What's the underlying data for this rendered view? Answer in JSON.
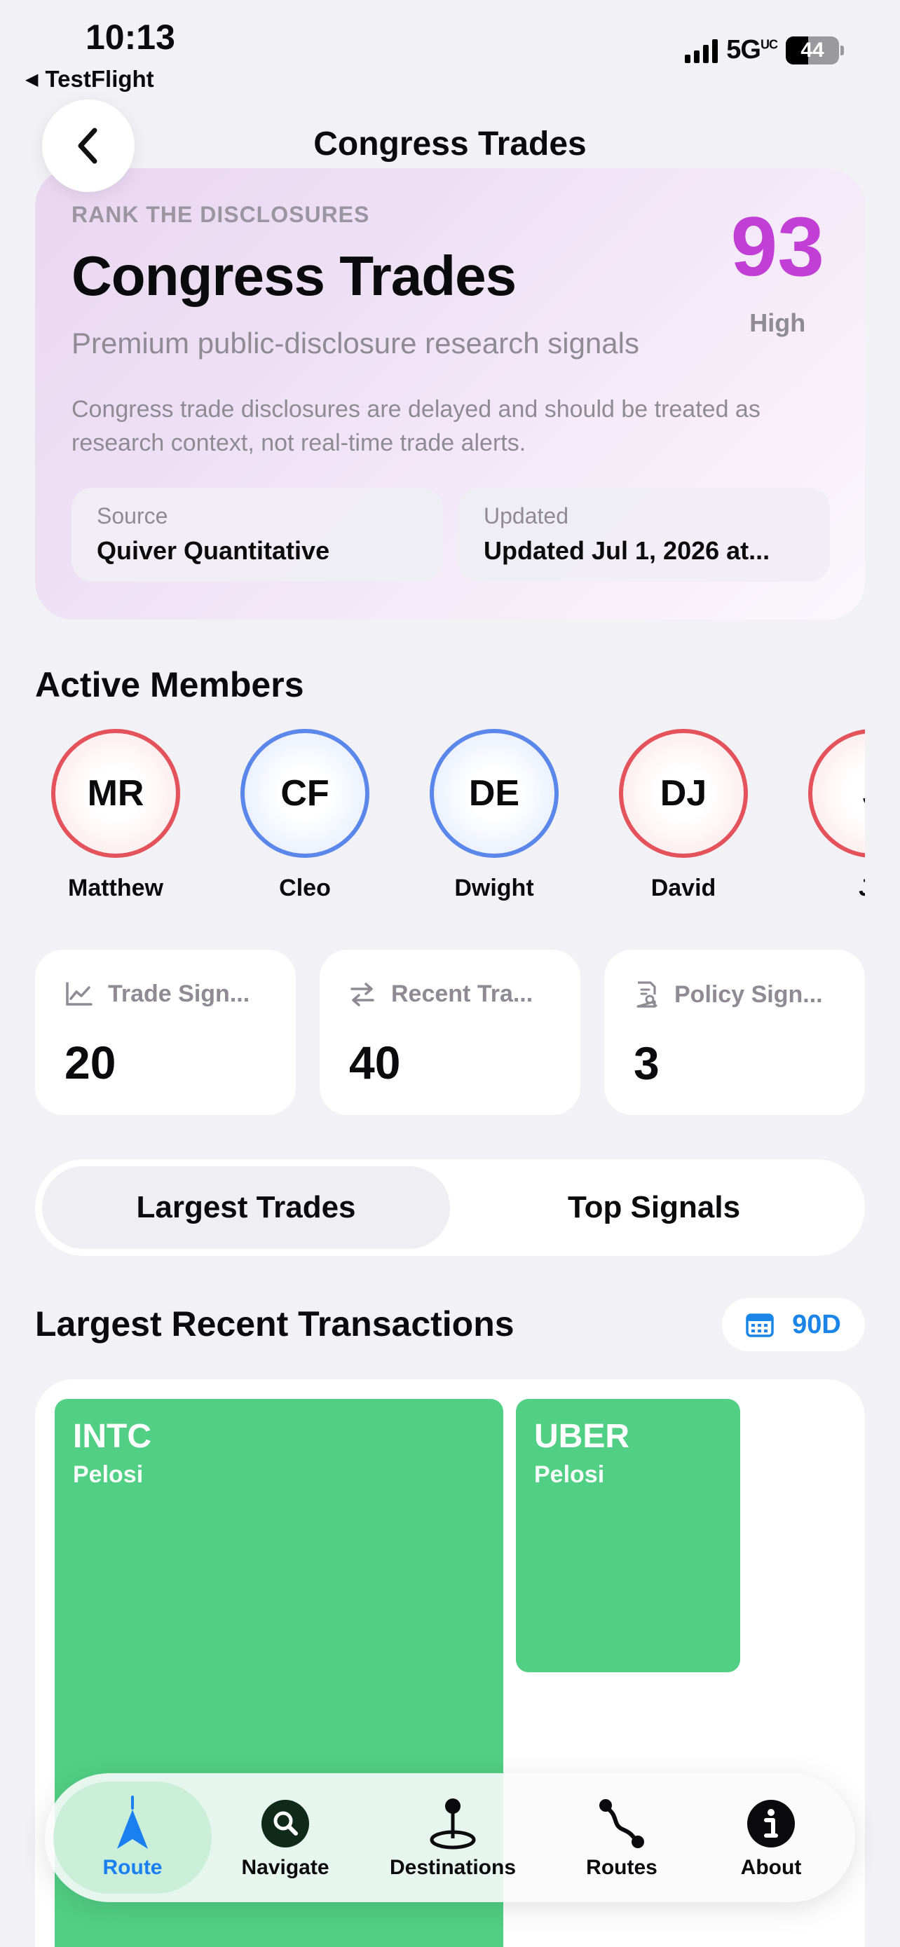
{
  "status_bar": {
    "time": "10:13",
    "back_app": "TestFlight",
    "network": "5G",
    "network_sup": "UC",
    "battery": "44"
  },
  "nav": {
    "title": "Congress Trades"
  },
  "hero": {
    "kicker": "RANK THE DISCLOSURES",
    "title": "Congress Trades",
    "subtitle": "Premium public-disclosure research signals",
    "note": "Congress trade disclosures are delayed and should be treated as research context, not real-time trade alerts.",
    "score": "93",
    "score_label": "High",
    "source_label": "Source",
    "source_value": "Quiver Quantitative",
    "updated_label": "Updated",
    "updated_value": "Updated Jul 1, 2026 at..."
  },
  "members": {
    "title": "Active Members",
    "items": [
      {
        "initials": "MR",
        "name": "Matthew",
        "party_color": "red"
      },
      {
        "initials": "CF",
        "name": "Cleo",
        "party_color": "blue"
      },
      {
        "initials": "DE",
        "name": "Dwight",
        "party_color": "blue"
      },
      {
        "initials": "DJ",
        "name": "David",
        "party_color": "red"
      },
      {
        "initials": "J",
        "name": "Jo",
        "party_color": "red"
      }
    ]
  },
  "stats": [
    {
      "label": "Trade Sign...",
      "value": "20",
      "icon": "chart-line-icon"
    },
    {
      "label": "Recent Tra...",
      "value": "40",
      "icon": "arrows-swap-icon"
    },
    {
      "label": "Policy Sign...",
      "value": "3",
      "icon": "document-search-icon"
    }
  ],
  "segment": {
    "options": [
      "Largest Trades",
      "Top Signals"
    ],
    "selected": "Largest Trades"
  },
  "transactions": {
    "title": "Largest Recent Transactions",
    "range": "90D",
    "tiles": [
      {
        "symbol": "INTC",
        "member": "Pelosi"
      },
      {
        "symbol": "UBER",
        "member": "Pelosi"
      }
    ]
  },
  "tabbar": {
    "items": [
      {
        "label": "Route",
        "icon": "navigation-arrow-icon",
        "active": true
      },
      {
        "label": "Navigate",
        "icon": "search-icon",
        "active": false
      },
      {
        "label": "Destinations",
        "icon": "pin-icon",
        "active": false
      },
      {
        "label": "Routes",
        "icon": "route-icon",
        "active": false
      },
      {
        "label": "About",
        "icon": "info-icon",
        "active": false
      }
    ]
  },
  "colors": {
    "accent": "#1a85e6",
    "score": "#c23fd6",
    "tile": "#51cf84",
    "republican": "#e4535b",
    "democrat": "#5b86ea"
  }
}
